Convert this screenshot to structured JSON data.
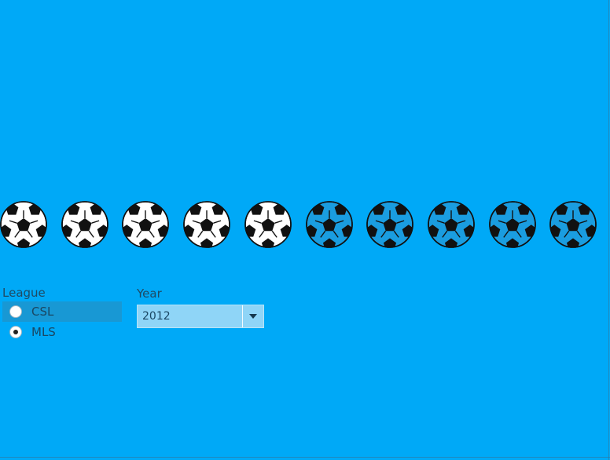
{
  "balls": {
    "items": [
      {
        "state": "filled"
      },
      {
        "state": "filled"
      },
      {
        "state": "filled"
      },
      {
        "state": "filled"
      },
      {
        "state": "filled"
      },
      {
        "state": "empty"
      },
      {
        "state": "empty"
      },
      {
        "state": "empty"
      },
      {
        "state": "empty"
      },
      {
        "state": "empty"
      }
    ],
    "filled_count": 5,
    "total": 10,
    "icon": "soccer-ball-icon"
  },
  "league_filter": {
    "title": "League",
    "options": [
      {
        "label": "CSL",
        "selected": false
      },
      {
        "label": "MLS",
        "selected": true
      }
    ]
  },
  "year_filter": {
    "title": "Year",
    "value": "2012"
  },
  "colors": {
    "background": "#00A9F7",
    "ball_filled": "#FFFFFF",
    "ball_empty": "#1A9DE0",
    "ball_outline": "#111111"
  }
}
